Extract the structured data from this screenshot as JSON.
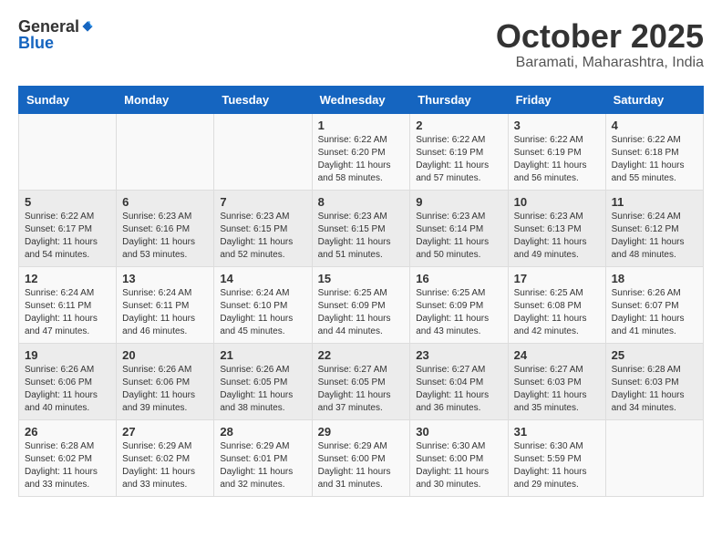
{
  "logo": {
    "general": "General",
    "blue": "Blue"
  },
  "title": "October 2025",
  "location": "Baramati, Maharashtra, India",
  "weekdays": [
    "Sunday",
    "Monday",
    "Tuesday",
    "Wednesday",
    "Thursday",
    "Friday",
    "Saturday"
  ],
  "weeks": [
    [
      {
        "day": "",
        "info": ""
      },
      {
        "day": "",
        "info": ""
      },
      {
        "day": "",
        "info": ""
      },
      {
        "day": "1",
        "info": "Sunrise: 6:22 AM\nSunset: 6:20 PM\nDaylight: 11 hours\nand 58 minutes."
      },
      {
        "day": "2",
        "info": "Sunrise: 6:22 AM\nSunset: 6:19 PM\nDaylight: 11 hours\nand 57 minutes."
      },
      {
        "day": "3",
        "info": "Sunrise: 6:22 AM\nSunset: 6:19 PM\nDaylight: 11 hours\nand 56 minutes."
      },
      {
        "day": "4",
        "info": "Sunrise: 6:22 AM\nSunset: 6:18 PM\nDaylight: 11 hours\nand 55 minutes."
      }
    ],
    [
      {
        "day": "5",
        "info": "Sunrise: 6:22 AM\nSunset: 6:17 PM\nDaylight: 11 hours\nand 54 minutes."
      },
      {
        "day": "6",
        "info": "Sunrise: 6:23 AM\nSunset: 6:16 PM\nDaylight: 11 hours\nand 53 minutes."
      },
      {
        "day": "7",
        "info": "Sunrise: 6:23 AM\nSunset: 6:15 PM\nDaylight: 11 hours\nand 52 minutes."
      },
      {
        "day": "8",
        "info": "Sunrise: 6:23 AM\nSunset: 6:15 PM\nDaylight: 11 hours\nand 51 minutes."
      },
      {
        "day": "9",
        "info": "Sunrise: 6:23 AM\nSunset: 6:14 PM\nDaylight: 11 hours\nand 50 minutes."
      },
      {
        "day": "10",
        "info": "Sunrise: 6:23 AM\nSunset: 6:13 PM\nDaylight: 11 hours\nand 49 minutes."
      },
      {
        "day": "11",
        "info": "Sunrise: 6:24 AM\nSunset: 6:12 PM\nDaylight: 11 hours\nand 48 minutes."
      }
    ],
    [
      {
        "day": "12",
        "info": "Sunrise: 6:24 AM\nSunset: 6:11 PM\nDaylight: 11 hours\nand 47 minutes."
      },
      {
        "day": "13",
        "info": "Sunrise: 6:24 AM\nSunset: 6:11 PM\nDaylight: 11 hours\nand 46 minutes."
      },
      {
        "day": "14",
        "info": "Sunrise: 6:24 AM\nSunset: 6:10 PM\nDaylight: 11 hours\nand 45 minutes."
      },
      {
        "day": "15",
        "info": "Sunrise: 6:25 AM\nSunset: 6:09 PM\nDaylight: 11 hours\nand 44 minutes."
      },
      {
        "day": "16",
        "info": "Sunrise: 6:25 AM\nSunset: 6:09 PM\nDaylight: 11 hours\nand 43 minutes."
      },
      {
        "day": "17",
        "info": "Sunrise: 6:25 AM\nSunset: 6:08 PM\nDaylight: 11 hours\nand 42 minutes."
      },
      {
        "day": "18",
        "info": "Sunrise: 6:26 AM\nSunset: 6:07 PM\nDaylight: 11 hours\nand 41 minutes."
      }
    ],
    [
      {
        "day": "19",
        "info": "Sunrise: 6:26 AM\nSunset: 6:06 PM\nDaylight: 11 hours\nand 40 minutes."
      },
      {
        "day": "20",
        "info": "Sunrise: 6:26 AM\nSunset: 6:06 PM\nDaylight: 11 hours\nand 39 minutes."
      },
      {
        "day": "21",
        "info": "Sunrise: 6:26 AM\nSunset: 6:05 PM\nDaylight: 11 hours\nand 38 minutes."
      },
      {
        "day": "22",
        "info": "Sunrise: 6:27 AM\nSunset: 6:05 PM\nDaylight: 11 hours\nand 37 minutes."
      },
      {
        "day": "23",
        "info": "Sunrise: 6:27 AM\nSunset: 6:04 PM\nDaylight: 11 hours\nand 36 minutes."
      },
      {
        "day": "24",
        "info": "Sunrise: 6:27 AM\nSunset: 6:03 PM\nDaylight: 11 hours\nand 35 minutes."
      },
      {
        "day": "25",
        "info": "Sunrise: 6:28 AM\nSunset: 6:03 PM\nDaylight: 11 hours\nand 34 minutes."
      }
    ],
    [
      {
        "day": "26",
        "info": "Sunrise: 6:28 AM\nSunset: 6:02 PM\nDaylight: 11 hours\nand 33 minutes."
      },
      {
        "day": "27",
        "info": "Sunrise: 6:29 AM\nSunset: 6:02 PM\nDaylight: 11 hours\nand 33 minutes."
      },
      {
        "day": "28",
        "info": "Sunrise: 6:29 AM\nSunset: 6:01 PM\nDaylight: 11 hours\nand 32 minutes."
      },
      {
        "day": "29",
        "info": "Sunrise: 6:29 AM\nSunset: 6:00 PM\nDaylight: 11 hours\nand 31 minutes."
      },
      {
        "day": "30",
        "info": "Sunrise: 6:30 AM\nSunset: 6:00 PM\nDaylight: 11 hours\nand 30 minutes."
      },
      {
        "day": "31",
        "info": "Sunrise: 6:30 AM\nSunset: 5:59 PM\nDaylight: 11 hours\nand 29 minutes."
      },
      {
        "day": "",
        "info": ""
      }
    ]
  ]
}
